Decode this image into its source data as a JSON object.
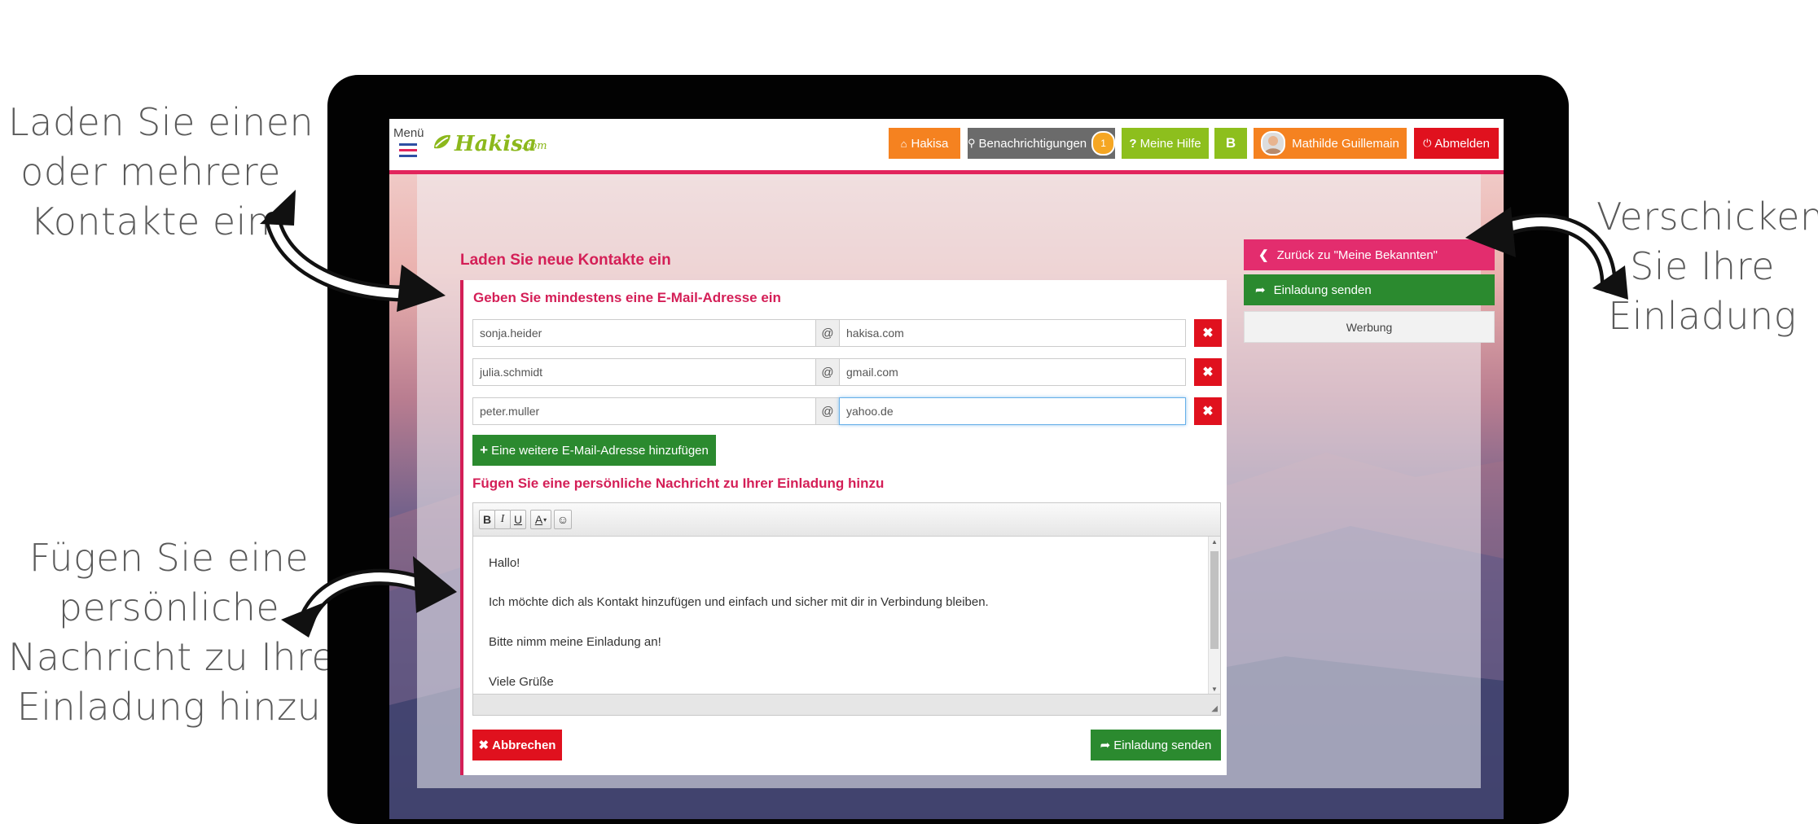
{
  "annotations": {
    "load_contacts": [
      "Laden Sie einen",
      "oder mehrere",
      "Kontakte ein"
    ],
    "send_invitation": [
      "Verschicken",
      "Sie Ihre",
      "Einladung"
    ],
    "personal_message": [
      "Fügen Sie eine",
      "persönliche",
      "Nachricht zu Ihrer",
      "Einladung hinzu"
    ]
  },
  "topbar": {
    "menu_label": "Menü",
    "logo_text": "Hakisa",
    "logo_domain": ".com",
    "home_label": "Hakisa",
    "notifications_label": "Benachrichtigungen",
    "notifications_count": "1",
    "help_label": "Meine Hilfe",
    "b_label": "B",
    "user_name": "Mathilde Guillemain",
    "logout_label": "Abmelden"
  },
  "main": {
    "title": "Laden Sie neue Kontakte ein",
    "email_section_title": "Geben Sie mindestens eine E-Mail-Adresse ein",
    "at_symbol": "@",
    "emails": [
      {
        "user": "sonja.heider",
        "domain": "hakisa.com"
      },
      {
        "user": "julia.schmidt",
        "domain": "gmail.com"
      },
      {
        "user": "peter.muller",
        "domain": "yahoo.de"
      }
    ],
    "add_email_label": "Eine weitere E-Mail-Adresse hinzufügen",
    "message_section_title": "Fügen Sie eine persönliche Nachricht zu Ihrer Einladung hinzu",
    "editor_toolbar": {
      "bold": "B",
      "italic": "I",
      "underline": "U",
      "color": "A"
    },
    "message_lines": [
      "Hallo!",
      "Ich möchte dich als Kontakt hinzufügen und einfach und sicher mit dir in Verbindung bleiben.",
      "Bitte nimm meine Einladung an!",
      "Viele Grüße"
    ],
    "cancel_label": "Abbrechen",
    "send_label": "Einladung senden"
  },
  "sidebar": {
    "back_label": "Zurück zu \"Meine Bekannten\"",
    "send_label": "Einladung senden",
    "ad_label": "Werbung"
  },
  "colors": {
    "accent_pink": "#d41f57",
    "orange": "#f58220",
    "green": "#2b8a2f",
    "lime": "#8dbf1d",
    "red": "#e0111e"
  }
}
